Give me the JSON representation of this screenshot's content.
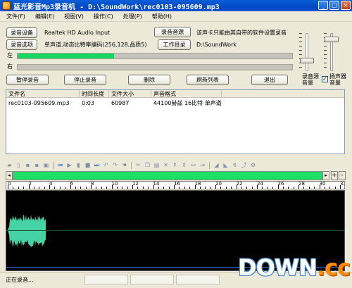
{
  "window": {
    "title": "蓝光影音Mp3录音机 - D:\\SoundWork\\rec0103-095609.mp3",
    "minimize": "_",
    "maximize": "□",
    "close": "×"
  },
  "menu": [
    {
      "label": "文件(F)"
    },
    {
      "label": "编辑(E)"
    },
    {
      "label": "视图(V)"
    },
    {
      "label": "操作(C)"
    },
    {
      "label": "处理(P)"
    },
    {
      "label": "帮助(H)"
    }
  ],
  "controls": {
    "record_device_button": "录音设备",
    "device_name": "Realtek HD Audio Input",
    "record_source_button": "录音音源",
    "source_hint": "该声卡只能由其自带的软件设置录音",
    "record_options_button": "录音选项",
    "options_summary": "单声道,动态比特率编码(256,128,品质5)",
    "work_dir_button": "工作目录",
    "work_dir_path": "D:\\SoundWork"
  },
  "meters": {
    "left_label": "左",
    "right_label": "右",
    "left_level": 0.35,
    "right_level": 0.0
  },
  "actions": {
    "pause": "暂停录音",
    "stop": "停止录音",
    "delete": "删除",
    "refresh": "刷新列表",
    "exit": "退出"
  },
  "volume": {
    "source_label": "录音源音量",
    "speaker_label": "扬声器音量",
    "speaker_checked": true,
    "check_mark": "✓",
    "source_level": 0.25,
    "speaker_level": 0.9
  },
  "file_list": {
    "columns": [
      "文件名",
      "时间长度",
      "文件大小",
      "声音格式"
    ],
    "rows": [
      [
        "rec0103-095609.mp3",
        "0:03",
        "60987",
        "44100赫兹 16比特 单声道"
      ]
    ]
  },
  "editor": {
    "ruler_ticks": [
      "0",
      "2",
      "4",
      "6",
      "8",
      "10",
      "12",
      "14",
      "16",
      "18",
      "20",
      "22",
      "24",
      "26",
      "28",
      "30",
      "32"
    ],
    "scroll_left": "◂",
    "scroll_right": "▸",
    "zoom_in": "+",
    "zoom_out": "-"
  },
  "status": {
    "text": "正在录音..."
  },
  "watermark": {
    "part1": "DOWN",
    "dot": ".",
    "part2": "cc"
  },
  "colors": {
    "meter_fill": "#18d860",
    "waveform": "#45d2a4",
    "wave_background": "#000000"
  }
}
